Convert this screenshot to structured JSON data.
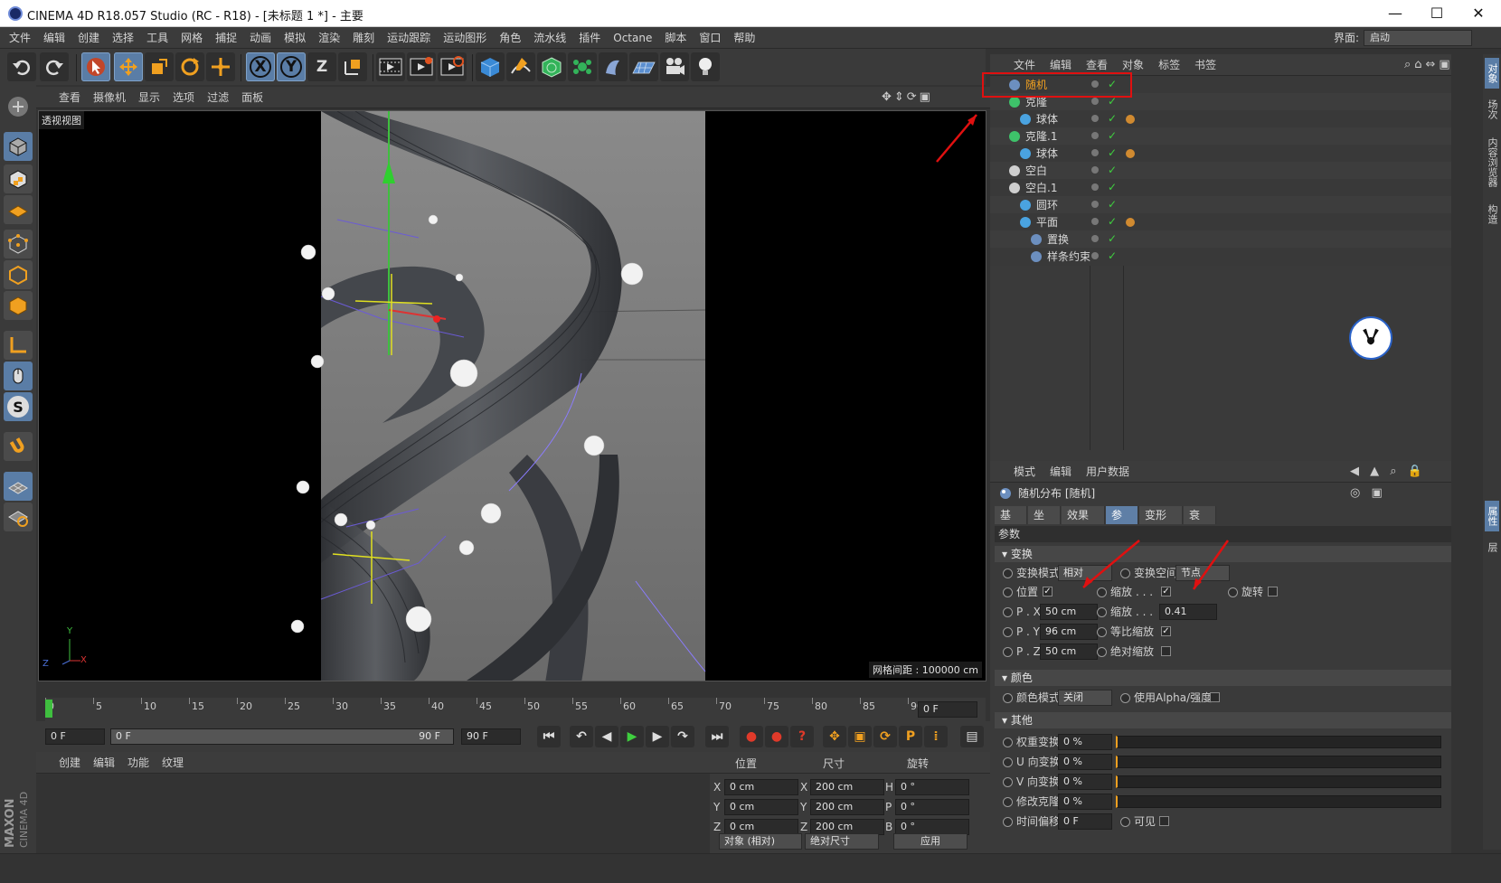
{
  "window": {
    "title": "CINEMA 4D R18.057 Studio (RC - R18) - [未标题 1 *] - 主要",
    "min": "—",
    "max": "☐",
    "close": "✕"
  },
  "menu": [
    "文件",
    "编辑",
    "创建",
    "选择",
    "工具",
    "网格",
    "捕捉",
    "动画",
    "模拟",
    "渲染",
    "雕刻",
    "运动跟踪",
    "运动图形",
    "角色",
    "流水线",
    "插件",
    "Octane",
    "脚本",
    "窗口",
    "帮助"
  ],
  "layout": {
    "label": "界面:",
    "value": "启动"
  },
  "viewport": {
    "menu": [
      "查看",
      "摄像机",
      "显示",
      "选项",
      "过滤",
      "面板"
    ],
    "view_name": "透视视图",
    "grid_distance": "网格间距 : 100000 cm",
    "axis": {
      "x": "X",
      "y": "Y",
      "z": "Z"
    }
  },
  "toolbar": {
    "x": "X",
    "y": "Y",
    "z": "Z"
  },
  "left_tools": {
    "s": "S"
  },
  "object_manager": {
    "menu": [
      "文件",
      "编辑",
      "查看",
      "对象",
      "标签",
      "书签"
    ],
    "objects": [
      {
        "name": "随机",
        "indent": 0,
        "color": "#6c8fbf",
        "highlight": true
      },
      {
        "name": "克隆",
        "indent": 0,
        "color": "#3ec26a"
      },
      {
        "name": "球体",
        "indent": 1,
        "color": "#4aa3e0"
      },
      {
        "name": "克隆.1",
        "indent": 0,
        "color": "#3ec26a"
      },
      {
        "name": "球体",
        "indent": 1,
        "color": "#4aa3e0"
      },
      {
        "name": "空白",
        "indent": 0,
        "color": "#cfcfcf"
      },
      {
        "name": "空白.1",
        "indent": 0,
        "color": "#cfcfcf"
      },
      {
        "name": "圆环",
        "indent": 1,
        "color": "#4aa3e0"
      },
      {
        "name": "平面",
        "indent": 1,
        "color": "#4aa3e0"
      },
      {
        "name": "置换",
        "indent": 2,
        "color": "#6c8fbf"
      },
      {
        "name": "样条约束",
        "indent": 2,
        "color": "#6c8fbf"
      }
    ]
  },
  "attribute_manager": {
    "menu": [
      "模式",
      "编辑",
      "用户数据"
    ],
    "object_title": "随机分布 [随机]",
    "tabs": [
      "基本",
      "坐标",
      "效果器",
      "参数",
      "变形器",
      "衰减"
    ],
    "active_tab": "参数",
    "section_params": "参数",
    "transform": {
      "header": "变换",
      "mode_label": "变换模式",
      "mode_value": "相对",
      "space_label": "变换空间",
      "space_value": "节点",
      "position": "位置",
      "scale": "缩放",
      "rotation": "旋转",
      "px_label": "P . X",
      "px": "50 cm",
      "py_label": "P . Y",
      "py": "96 cm",
      "pz_label": "P . Z",
      "pz": "50 cm",
      "scale_val_label": "缩放",
      "scale_dots": ". . .",
      "scale_value": "0.41",
      "uniform": "等比缩放",
      "absolute": "绝对缩放"
    },
    "color": {
      "header": "颜色",
      "mode_label": "颜色模式",
      "mode_value": "关闭",
      "alpha": "使用Alpha/强度"
    },
    "other": {
      "header": "其他",
      "rows": [
        {
          "label": "权重变换",
          "value": "0 %"
        },
        {
          "label": "U 向变换",
          "value": "0 %"
        },
        {
          "label": "V 向变换",
          "value": "0 %"
        },
        {
          "label": "修改克隆",
          "value": "0 %"
        }
      ],
      "time_label": "时间偏移",
      "time_value": "0 F",
      "visible": "可见"
    }
  },
  "right_tabs": [
    "对象",
    "场次",
    "内容浏览器",
    "构造",
    "属性",
    "层"
  ],
  "timeline": {
    "ticks": [
      "0",
      "5",
      "10",
      "15",
      "20",
      "25",
      "30",
      "35",
      "40",
      "45",
      "50",
      "55",
      "60",
      "65",
      "70",
      "75",
      "80",
      "85",
      "90"
    ],
    "current": "0 F"
  },
  "playback": {
    "start": "0 F",
    "range_start": "0 F",
    "range_end": "90 F",
    "end": "90 F"
  },
  "material_manager": {
    "menu": [
      "创建",
      "编辑",
      "功能",
      "纹理"
    ]
  },
  "coords": {
    "headers": [
      "位置",
      "尺寸",
      "旋转"
    ],
    "rows": [
      {
        "axis": "X",
        "pos": "0 cm",
        "size_axis": "X",
        "size": "200 cm",
        "rot_axis": "H",
        "rot": "0 °"
      },
      {
        "axis": "Y",
        "pos": "0 cm",
        "size_axis": "Y",
        "size": "200 cm",
        "rot_axis": "P",
        "rot": "0 °"
      },
      {
        "axis": "Z",
        "pos": "0 cm",
        "size_axis": "Z",
        "size": "200 cm",
        "rot_axis": "B",
        "rot": "0 °"
      }
    ],
    "mode": "对象 (相对)",
    "size_mode": "绝对尺寸",
    "apply": "应用"
  },
  "brand": {
    "maxon": "MAXON",
    "c4d": "CINEMA 4D"
  }
}
